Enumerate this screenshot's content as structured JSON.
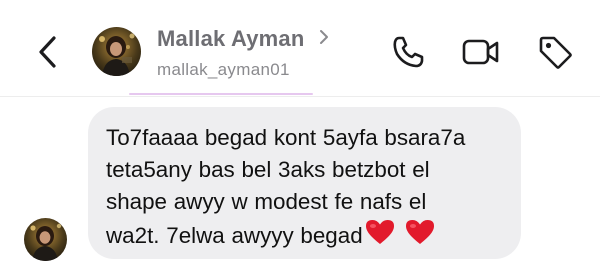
{
  "header": {
    "contact_name": "Mallak Ayman",
    "username": "mallak_ayman01",
    "icons": {
      "back": "chevron-left-icon",
      "profile_chevron": "chevron-right-icon",
      "call": "phone-icon",
      "video": "video-camera-icon",
      "tag": "tag-icon"
    }
  },
  "message": {
    "lines": [
      "To7faaaa begad kont 5ayfa bsara7a",
      "teta5any bas bel 3aks betzbot el",
      "shape awyy w modest fe nafs el",
      "wa2t. 7elwa awyyy begad"
    ],
    "emoji": "heart-icon",
    "emoji_count": 2
  },
  "colors": {
    "bubble": "#eeeef0",
    "name": "#6e6e73",
    "username": "#8a8a8e",
    "accent_line": "#e6c8ef",
    "heart": "#e21a2c"
  }
}
